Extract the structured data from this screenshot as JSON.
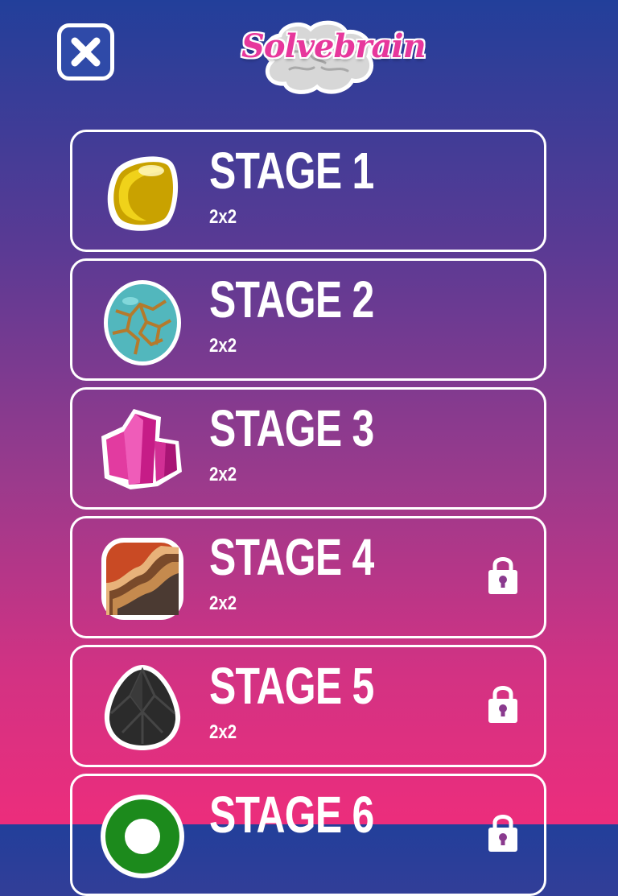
{
  "header": {
    "close_icon": "close-icon",
    "logo_text": "Solvebrain"
  },
  "colors": {
    "background_top": "#223f9a",
    "background_bottom": "#ec2d7c",
    "card_border": "#ffffff",
    "logo_pink": "#e7379c"
  },
  "stages": [
    {
      "title": "STAGE 1",
      "size": "2x2",
      "icon": "gold-gem-icon",
      "locked": false
    },
    {
      "title": "STAGE 2",
      "size": "2x2",
      "icon": "turquoise-stone-icon",
      "locked": false
    },
    {
      "title": "STAGE 3",
      "size": "2x2",
      "icon": "pink-crystal-icon",
      "locked": false
    },
    {
      "title": "STAGE 4",
      "size": "2x2",
      "icon": "agate-stone-icon",
      "locked": true
    },
    {
      "title": "STAGE 5",
      "size": "2x2",
      "icon": "black-gem-icon",
      "locked": true
    },
    {
      "title": "STAGE 6",
      "size": "",
      "icon": "green-ring-gem-icon",
      "locked": true
    }
  ]
}
